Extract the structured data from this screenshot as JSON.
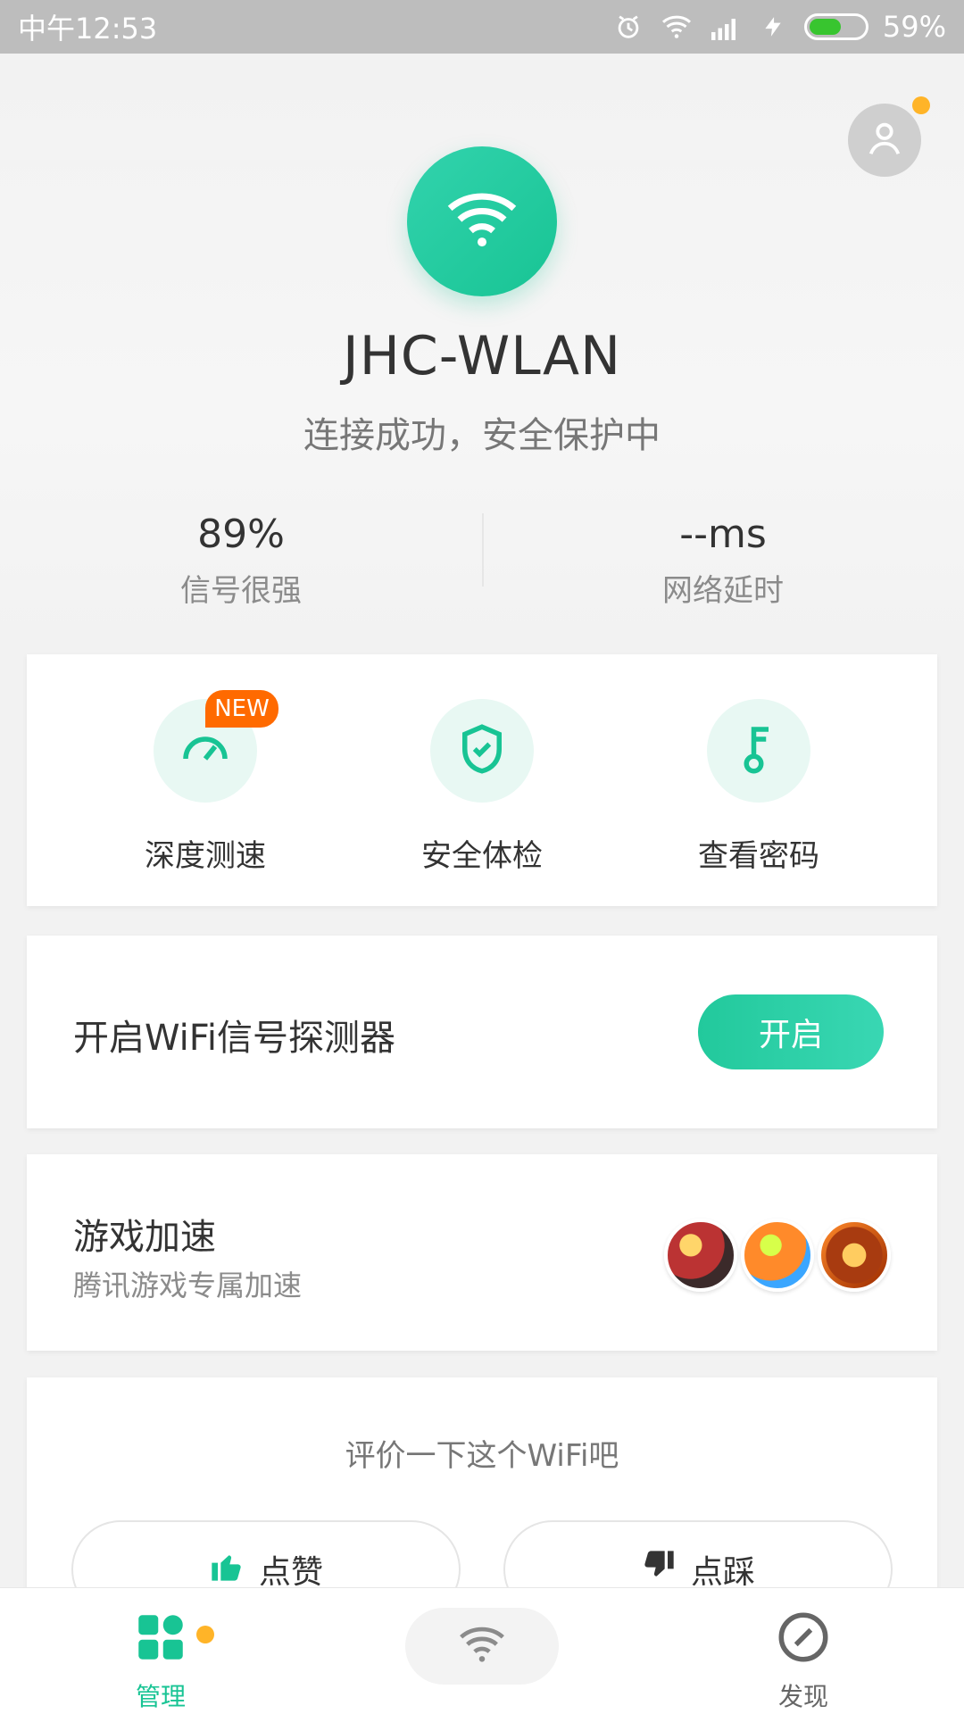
{
  "status_bar": {
    "time": "中午12:53",
    "battery_percent": "59%",
    "battery_level": 0.59,
    "icons": [
      "alarm-icon",
      "wifi-icon",
      "signal-icon",
      "charging-icon",
      "battery-icon"
    ]
  },
  "header": {
    "ssid": "JHC-WLAN",
    "status": "连接成功，安全保护中",
    "signal": {
      "value": "89%",
      "label": "信号很强"
    },
    "latency": {
      "value": "--ms",
      "label": "网络延时"
    }
  },
  "tools": {
    "new_badge": "NEW",
    "items": [
      {
        "label": "深度测速",
        "icon": "speedometer-icon"
      },
      {
        "label": "安全体检",
        "icon": "shield-check-icon"
      },
      {
        "label": "查看密码",
        "icon": "key-icon"
      }
    ]
  },
  "detector": {
    "title": "开启WiFi信号探测器",
    "button_label": "开启"
  },
  "game_boost": {
    "title": "游戏加速",
    "subtitle": "腾讯游戏专属加速"
  },
  "rating": {
    "title": "评价一下这个WiFi吧",
    "like_label": "点赞",
    "dislike_label": "点踩"
  },
  "bottom_nav": {
    "left_label": "管理",
    "right_label": "发现"
  },
  "colors": {
    "accent": "#18c494",
    "badge": "#ff6a00",
    "dot": "#ffb428"
  }
}
